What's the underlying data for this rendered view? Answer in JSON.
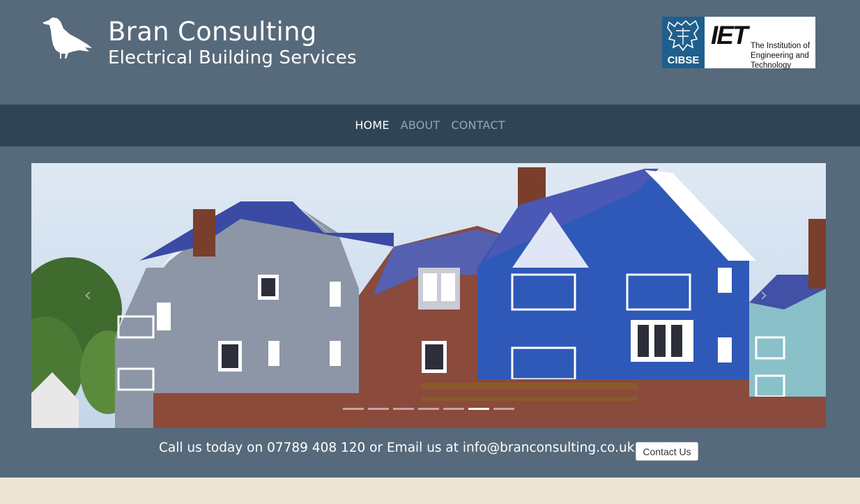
{
  "header": {
    "title": "Bran Consulting",
    "subtitle": "Electrical Building Services",
    "logo_icon": "raven-icon",
    "badges": {
      "cibse": "CIBSE",
      "iet_mark": "IET",
      "iet_name": "The Institution of Engineering and Technology"
    }
  },
  "nav": {
    "items": [
      {
        "label": "HOME",
        "active": true
      },
      {
        "label": "ABOUT",
        "active": false
      },
      {
        "label": "CONTACT",
        "active": false
      }
    ]
  },
  "carousel": {
    "prev_icon": "chevron-left-icon",
    "next_icon": "chevron-right-icon",
    "slide_count": 7,
    "active_slide": 6
  },
  "cta": {
    "text": "Call us today on 07789 408 120 or Email us at info@branconsulting.co.uk",
    "button_label": "Contact Us"
  },
  "colors": {
    "header_bg": "#566a7b",
    "nav_bg": "#2f4556",
    "footer_bg": "#ede4d6",
    "nav_active": "#ffffff",
    "nav_inactive": "#9aa6b1"
  }
}
